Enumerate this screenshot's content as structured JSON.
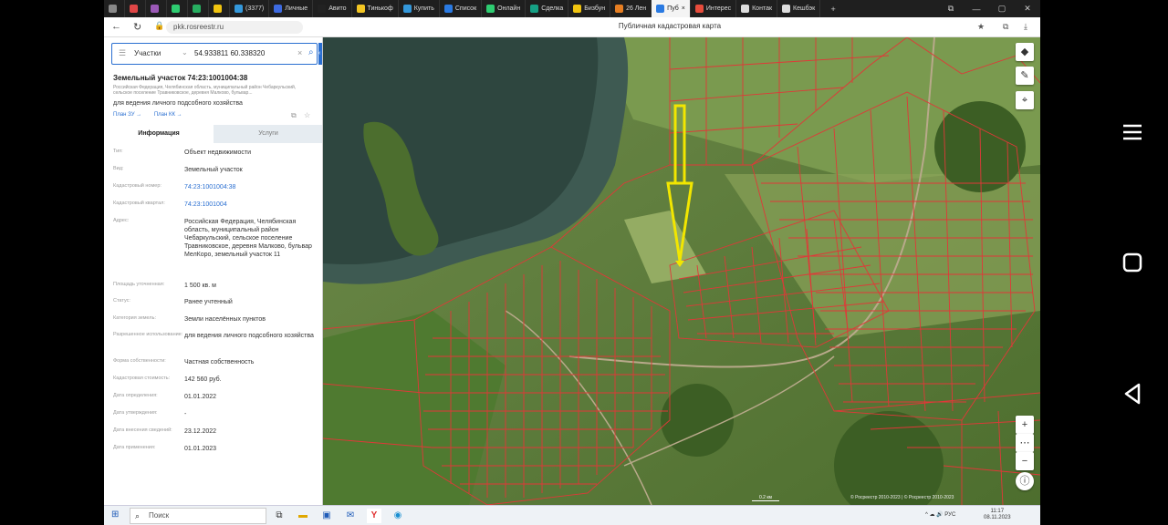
{
  "browser": {
    "tabs": [
      {
        "label": "",
        "color": "#888888"
      },
      {
        "label": "",
        "color": "#e04646"
      },
      {
        "label": "",
        "color": "#9b59b6"
      },
      {
        "label": "",
        "color": "#2ecc71"
      },
      {
        "label": "",
        "color": "#27ae60"
      },
      {
        "label": "",
        "color": "#f1c40f"
      },
      {
        "label": "(3377)",
        "color": "#3498db"
      },
      {
        "label": "Личные",
        "color": "#3d6ae0"
      },
      {
        "label": "Авито",
        "color": "#222222"
      },
      {
        "label": "Тинькоф",
        "color": "#f3c623"
      },
      {
        "label": "Купить",
        "color": "#3498db"
      },
      {
        "label": "Список",
        "color": "#2a7ae2"
      },
      {
        "label": "Онлайн",
        "color": "#2ecc71"
      },
      {
        "label": "Сделка",
        "color": "#16a085"
      },
      {
        "label": "Бизбун",
        "color": "#f1c40f"
      },
      {
        "label": "26 Лен",
        "color": "#e67e22"
      },
      {
        "label": "Пуб",
        "color": "#2a7ae2"
      },
      {
        "label": "Интерес",
        "color": "#e74c3c"
      },
      {
        "label": "Контак",
        "color": "#dddddd"
      },
      {
        "label": "Кешбэк",
        "color": "#dddddd"
      }
    ],
    "active_tab_index": 16,
    "url": "pkk.rosreestr.ru",
    "page_title": "Публичная кадастровая карта"
  },
  "panel": {
    "search_category": "Участки",
    "search_query": "54.933811 60.338320",
    "object_title": "Земельный участок 74:23:1001004:38",
    "object_address_short": "Российская Федерация, Челябинская область, муниципальный район Чебаркульский, сельское поселение Травниковское, деревня Малково, бульвар...",
    "object_use": "для ведения личного подсобного хозяйства",
    "link_1": "План ЗУ →",
    "link_2": "План КК →",
    "tab_info": "Информация",
    "tab_services": "Услуги",
    "rows": [
      {
        "key": "Тип:",
        "value": "Объект недвижимости",
        "link": false
      },
      {
        "key": "Вид:",
        "value": "Земельный участок",
        "link": false
      },
      {
        "key": "Кадастровый номер:",
        "value": "74:23:1001004:38",
        "link": true
      },
      {
        "key": "Кадастровый квартал:",
        "value": "74:23:1001004",
        "link": true
      },
      {
        "key": "Адрес:",
        "value": "Российская Федерация, Челябинская область, муниципальный район Чебаркульский, сельское поселение Травниковское, деревня Малково, бульвар МелКоро, земельный участок 11",
        "link": false
      },
      {
        "key": "Площадь уточненная:",
        "value": "1 500 кв. м",
        "link": false
      },
      {
        "key": "Статус:",
        "value": "Ранее учтенный",
        "link": false
      },
      {
        "key": "Категория земель:",
        "value": "Земли населённых пунктов",
        "link": false
      },
      {
        "key": "Разрешенное использование:",
        "value": "для ведения личного подсобного хозяйства",
        "link": false
      },
      {
        "key": "Форма собственности:",
        "value": "Частная собственность",
        "link": false
      },
      {
        "key": "Кадастровая стоимость:",
        "value": "142 560 руб.",
        "link": false
      },
      {
        "key": "Дата определения:",
        "value": "01.01.2022",
        "link": false
      },
      {
        "key": "Дата утверждения:",
        "value": "-",
        "link": false
      },
      {
        "key": "Дата внесения сведений:",
        "value": "23.12.2022",
        "link": false
      },
      {
        "key": "Дата применения:",
        "value": "01.01.2023",
        "link": false
      }
    ]
  },
  "map": {
    "attribution": "© Росреестр 2010-2023 | © Росреестр 2010-2023",
    "scale": "0.2 км",
    "arrow_color": "#f2e600",
    "parcel_color": "#e03838"
  },
  "taskbar": {
    "search_placeholder": "Поиск",
    "tray": "^ ☁ 🔊 РУС",
    "time": "11:17",
    "date": "08.11.2023"
  }
}
